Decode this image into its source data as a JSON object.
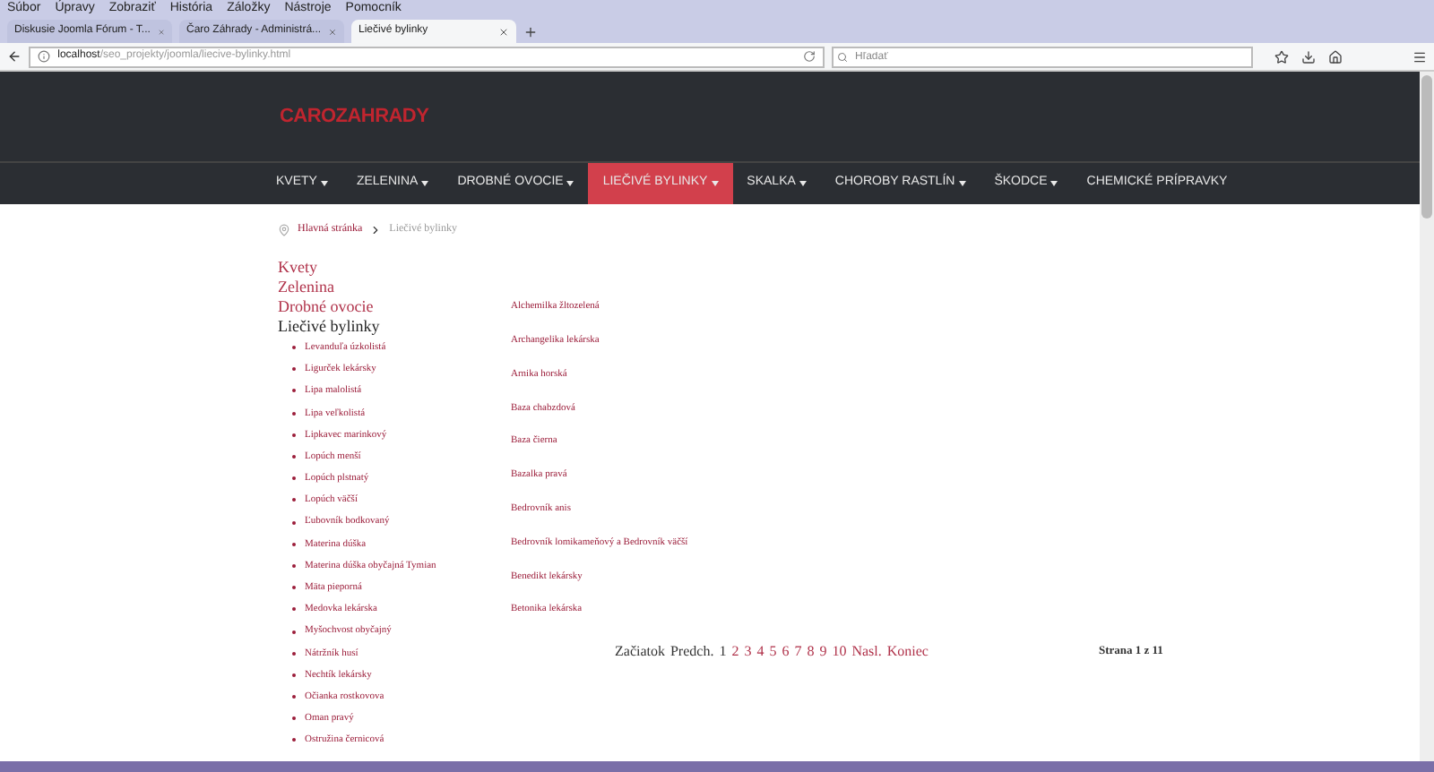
{
  "browser": {
    "menu": [
      "Súbor",
      "Úpravy",
      "Zobraziť",
      "História",
      "Záložky",
      "Nástroje",
      "Pomocník"
    ],
    "tabs": [
      {
        "title": "Diskusie Joomla Fórum - T...",
        "selected": false
      },
      {
        "title": "Čaro Záhrady - Administrá...",
        "selected": false
      },
      {
        "title": "Liečivé bylinky",
        "selected": true
      }
    ],
    "address": {
      "host": "localhost",
      "path": "/seo_projekty/joomla/liecive-bylinky.html"
    },
    "search": {
      "placeholder": "Hľadať"
    }
  },
  "site": {
    "logo": "CAROZAHRADY"
  },
  "nav": [
    {
      "label": "KVETY",
      "has_menu": true,
      "selected": false
    },
    {
      "label": "ZELENINA",
      "has_menu": true,
      "selected": false
    },
    {
      "label": "DROBNÉ OVOCIE",
      "has_menu": true,
      "selected": false
    },
    {
      "label": "LIEČIVÉ BYLINKY",
      "has_menu": true,
      "selected": true
    },
    {
      "label": "SKALKA",
      "has_menu": true,
      "selected": false
    },
    {
      "label": "CHOROBY RASTLÍN",
      "has_menu": true,
      "selected": false
    },
    {
      "label": "ŠKODCE",
      "has_menu": true,
      "selected": false
    },
    {
      "label": "CHEMICKÉ PRÍPRAVKY",
      "has_menu": false,
      "selected": false
    }
  ],
  "breadcrumb": [
    {
      "label": "Hlavná stránka",
      "current": false
    },
    {
      "label": "Liečivé bylinky",
      "current": true
    }
  ],
  "sidebar": [
    {
      "label": "Kvety",
      "selected": false
    },
    {
      "label": "Zelenina",
      "selected": false
    },
    {
      "label": "Drobné ovocie",
      "selected": false
    },
    {
      "label": "Liečivé bylinky",
      "selected": true,
      "children": [
        "Levanduľa úzkolistá",
        "Ligurček lekársky",
        "Lipa malolistá",
        "Lipa veľkolistá",
        "Lipkavec marinkový",
        "Lopúch menší",
        "Lopúch plstnatý",
        "Lopúch väčší",
        "Ľubovník bodkovaný",
        "Materina dúška",
        "Materina dúška obyčajná Tymian",
        "Mäta pieporná",
        "Medovka lekárska",
        "Myšochvost obyčajný",
        "Nátržník husí",
        "Nechtík lekársky",
        "Očianka rostkovova",
        "Oman pravý",
        "Ostružina černicová"
      ]
    }
  ],
  "articles": [
    "Alchemilka žltozelená",
    "Archangelika lekárska",
    "Arnika horská",
    "Baza chabzdová",
    "Baza čierna",
    "Bazalka pravá",
    "Bedrovník anis",
    "Bedrovník lomikameňový a Bedrovník väčší",
    "Benedikt lekársky",
    "Betonika lekárska"
  ],
  "pagination": {
    "items": [
      {
        "label": "Začiatok",
        "disabled": true
      },
      {
        "label": "Predch.",
        "disabled": true
      },
      {
        "label": "1",
        "disabled": true
      },
      {
        "label": "2",
        "disabled": false
      },
      {
        "label": "3",
        "disabled": false
      },
      {
        "label": "4",
        "disabled": false
      },
      {
        "label": "5",
        "disabled": false
      },
      {
        "label": "6",
        "disabled": false
      },
      {
        "label": "7",
        "disabled": false
      },
      {
        "label": "8",
        "disabled": false
      },
      {
        "label": "9",
        "disabled": false
      },
      {
        "label": "10",
        "disabled": false
      },
      {
        "label": "Nasl.",
        "disabled": false
      },
      {
        "label": "Koniec",
        "disabled": false
      }
    ],
    "counter": "Strana 1 z 11"
  }
}
